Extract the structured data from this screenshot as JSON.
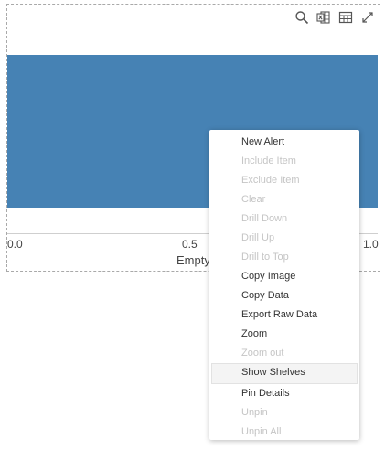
{
  "toolbar": {
    "icons": [
      "search-icon",
      "excel-export-icon",
      "table-view-icon",
      "expand-icon"
    ]
  },
  "chart_data": {
    "type": "bar",
    "orientation": "horizontal",
    "values": [
      1.0
    ],
    "xlim": [
      0,
      1.0
    ],
    "x_ticks": [
      "0.0",
      "0.5",
      "1.0"
    ],
    "xlabel": "Empty",
    "bar_color": "#4682b4"
  },
  "context_menu": {
    "items": [
      {
        "label": "New Alert",
        "enabled": true
      },
      {
        "label": "Include Item",
        "enabled": false
      },
      {
        "label": "Exclude Item",
        "enabled": false
      },
      {
        "label": "Clear",
        "enabled": false
      },
      {
        "label": "Drill Down",
        "enabled": false
      },
      {
        "label": "Drill Up",
        "enabled": false
      },
      {
        "label": "Drill to Top",
        "enabled": false
      },
      {
        "label": "Copy Image",
        "enabled": true
      },
      {
        "label": "Copy Data",
        "enabled": true
      },
      {
        "label": "Export Raw Data",
        "enabled": true
      },
      {
        "label": "Zoom",
        "enabled": true
      },
      {
        "label": "Zoom out",
        "enabled": false
      },
      {
        "label": "Show Shelves",
        "enabled": true,
        "hovered": true
      },
      {
        "label": "Pin Details",
        "enabled": true
      },
      {
        "label": "Unpin",
        "enabled": false
      },
      {
        "label": "Unpin All",
        "enabled": false
      }
    ]
  }
}
